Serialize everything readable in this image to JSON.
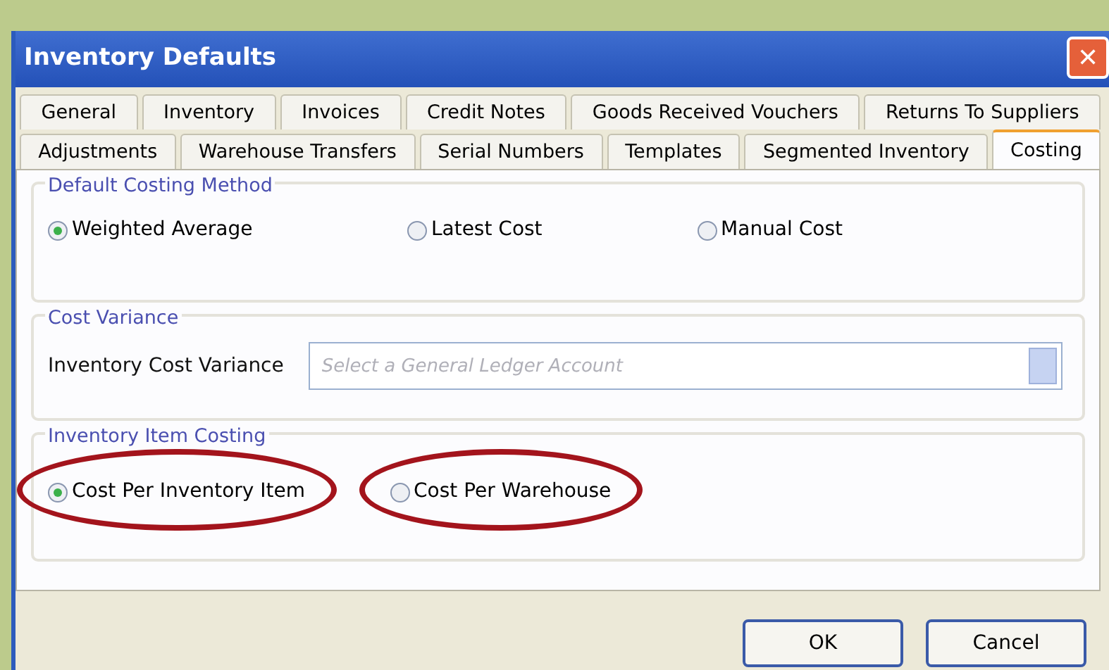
{
  "window": {
    "title": "Inventory Defaults",
    "close": "✕"
  },
  "tab_rows": [
    [
      {
        "label": "General",
        "selected": false
      },
      {
        "label": "Inventory",
        "selected": false
      },
      {
        "label": "Invoices",
        "selected": false
      },
      {
        "label": "Credit Notes",
        "selected": false
      },
      {
        "label": "Goods Received Vouchers",
        "selected": false
      },
      {
        "label": "Returns To Suppliers",
        "selected": false
      }
    ],
    [
      {
        "label": "Adjustments",
        "selected": false
      },
      {
        "label": "Warehouse Transfers",
        "selected": false
      },
      {
        "label": "Serial Numbers",
        "selected": false
      },
      {
        "label": "Templates",
        "selected": false
      },
      {
        "label": "Segmented Inventory",
        "selected": false
      },
      {
        "label": "Costing",
        "selected": true
      }
    ]
  ],
  "groups": [
    {
      "kind": "radios",
      "title": "Default Costing Method",
      "options": [
        {
          "label": "Weighted Average",
          "selected": true
        },
        {
          "label": "Latest Cost",
          "selected": false
        },
        {
          "label": "Manual Cost",
          "selected": false
        }
      ]
    },
    {
      "kind": "combo",
      "title": "Cost Variance",
      "label": "Inventory Cost Variance",
      "placeholder": "Select a General Ledger Account"
    },
    {
      "kind": "radios",
      "title": "Inventory Item Costing",
      "options": [
        {
          "label": "Cost Per Inventory Item",
          "selected": true,
          "circled": true
        },
        {
          "label": "Cost Per Warehouse",
          "selected": false,
          "circled": true
        }
      ]
    }
  ],
  "buttons": [
    "OK",
    "Cancel"
  ]
}
